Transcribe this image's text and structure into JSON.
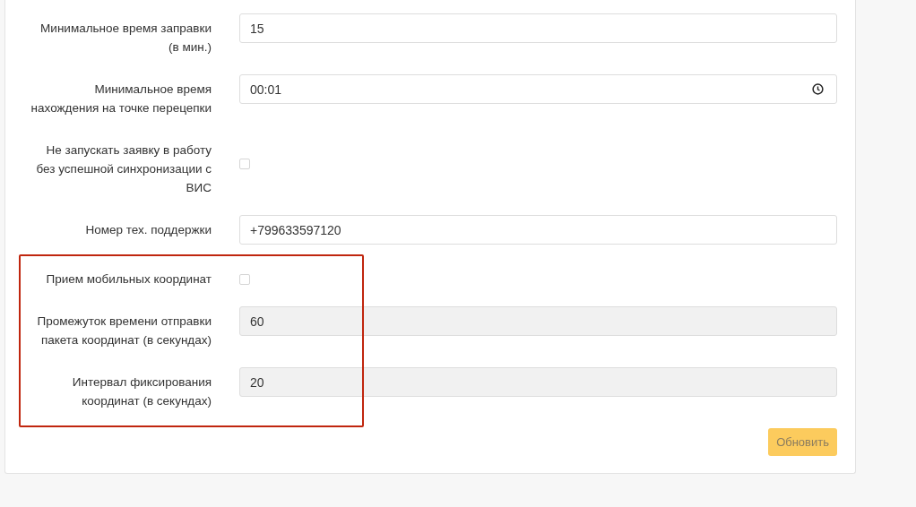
{
  "sections": [
    {
      "highlighted": false,
      "rows": [
        {
          "kind": "text",
          "label": "Минимальное время заправки (в мин.)",
          "value": "15",
          "disabled": false
        },
        {
          "kind": "time",
          "label": "Минимальное время нахождения на точке перецепки",
          "value": "00:01",
          "disabled": false
        },
        {
          "kind": "checkbox",
          "label": "Не запускать заявку в работу без успешной синхронизации с ВИС",
          "checked": false
        },
        {
          "kind": "text",
          "label": "Номер тех. поддержки",
          "value": "+799633597120",
          "disabled": false
        }
      ]
    },
    {
      "highlighted": true,
      "rows": [
        {
          "kind": "checkbox",
          "label": "Прием мобильных координат",
          "checked": false
        },
        {
          "kind": "text",
          "label": "Промежуток времени отправки пакета координат (в секундах)",
          "value": "60",
          "disabled": true
        },
        {
          "kind": "text",
          "label": "Интервал фиксирования координат (в секундах)",
          "value": "20",
          "disabled": true
        }
      ]
    }
  ],
  "submit": {
    "label": "Обновить",
    "disabled": true
  }
}
